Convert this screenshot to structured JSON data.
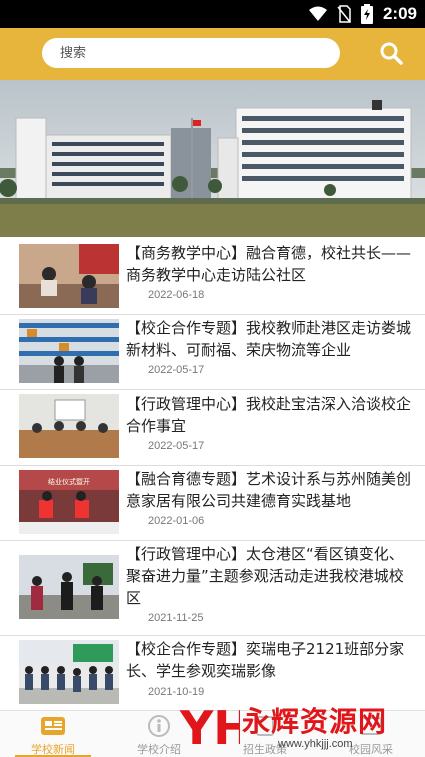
{
  "status": {
    "time": "2:09"
  },
  "search": {
    "placeholder": "搜索"
  },
  "news": [
    {
      "title": "【商务教学中心】融合育德，校社共长——商务教学中心走访陆公社区",
      "date": "2022-06-18"
    },
    {
      "title": "【校企合作专题】我校教师赴港区走访娄城新材料、可耐福、荣庆物流等企业",
      "date": "2022-05-17"
    },
    {
      "title": "【行政管理中心】我校赴宝洁深入洽谈校企合作事宜",
      "date": "2022-05-17"
    },
    {
      "title": "【融合育德专题】艺术设计系与苏州随美创意家居有限公司共建德育实践基地",
      "date": "2022-01-06"
    },
    {
      "title": "【行政管理中心】太仓港区“看区镇变化、聚奋进力量”主题参观活动走进我校港城校区",
      "date": "2021-11-25"
    },
    {
      "title": "【校企合作专题】奕瑞电子2121班部分家长、学生参观奕瑞影像",
      "date": "2021-10-19"
    }
  ],
  "thumb_captions": {
    "item4": "结业仪式暨开"
  },
  "tabs": [
    {
      "label": "学校新闻",
      "active": true
    },
    {
      "label": "学校介绍",
      "active": false
    },
    {
      "label": "招生政策",
      "active": false
    },
    {
      "label": "校园风采",
      "active": false
    }
  ],
  "watermark": {
    "text": "永辉资源网",
    "url": "www.yhkjjj.com",
    "logo": "YH"
  },
  "colors": {
    "accent": "#e8b53c",
    "active_tab": "#e8a52c",
    "watermark": "#e0161b"
  }
}
